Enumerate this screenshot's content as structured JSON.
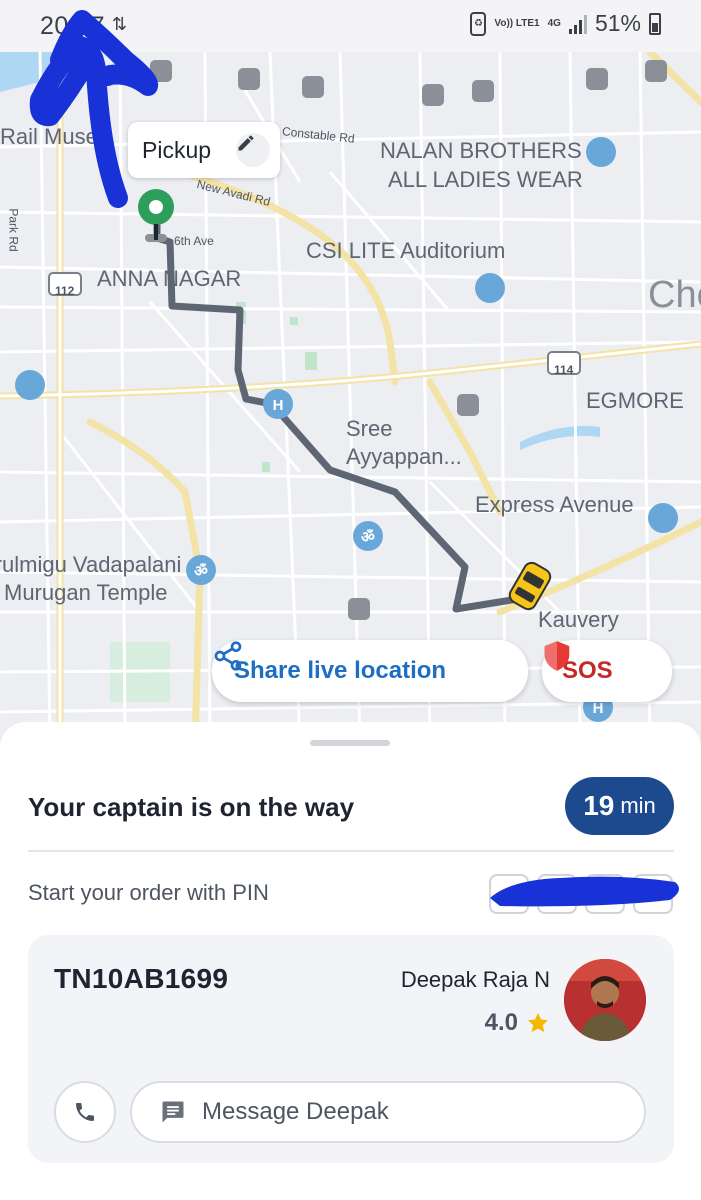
{
  "status_bar": {
    "time": "20:07",
    "volte": "Vo)) LTE1",
    "network": "4G",
    "battery": "51%"
  },
  "map": {
    "labels": {
      "rail_museum": "Rail Muse",
      "constable": "Constable Rd",
      "new_avadi": "New Avadi Rd",
      "nalan": "NALAN BROTHERS",
      "ladies": "ALL LADIES WEAR",
      "park_rd": "Park Rd",
      "sixth_ave": "6th Ave",
      "anna_nagar": "ANNA NAGAR",
      "csi": "CSI LITE Auditorium",
      "che": "Che",
      "route_112": "112",
      "route_114": "114",
      "egmore": "EGMORE",
      "sree": "Sree",
      "ayyappan": "Ayyappan...",
      "express": "Express Avenue",
      "vadapalani": "Arulmigu Vadapalani",
      "murugan": "Murugan Temple",
      "kauvery": "Kauvery"
    },
    "pickup_label": "Pickup",
    "share_label": "Share live location",
    "sos_label": "SOS"
  },
  "trip": {
    "status": "Your captain is on the way",
    "eta_value": "19",
    "eta_unit": "min",
    "pin_label": "Start your order with PIN",
    "vehicle_plate": "TN10AB1699",
    "captain_name": "Deepak Raja N",
    "rating": "4.0",
    "message_placeholder": "Message Deepak"
  },
  "colors": {
    "accent": "#1d4a8f",
    "link": "#1e6fc3",
    "sos": "#c62828",
    "route": "#5f6673",
    "pickup_pin": "#2e9e5b",
    "scribble": "#1832d8",
    "star": "#f5b800"
  }
}
